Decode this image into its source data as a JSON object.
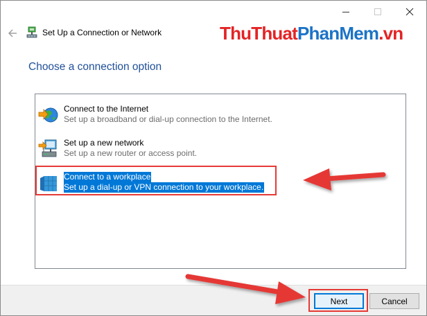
{
  "window": {
    "header_title": "Set Up a Connection or Network",
    "watermark": {
      "part1": "ThuThuat",
      "part2": "PhanMem",
      "part3": ".vn"
    }
  },
  "page": {
    "title": "Choose a connection option"
  },
  "options": [
    {
      "title": "Connect to the Internet",
      "description": "Set up a broadband or dial-up connection to the Internet.",
      "icon": "globe-network-icon",
      "selected": false
    },
    {
      "title": "Set up a new network",
      "description": "Set up a new router or access point.",
      "icon": "router-icon",
      "selected": false
    },
    {
      "title": "Connect to a workplace",
      "description": "Set up a dial-up or VPN connection to your workplace.",
      "icon": "workplace-icon",
      "selected": true
    }
  ],
  "footer": {
    "next_label": "Next",
    "cancel_label": "Cancel"
  },
  "colors": {
    "accent": "#0078d7",
    "title_blue": "#1f4f99",
    "annotation_red": "#e53935"
  }
}
